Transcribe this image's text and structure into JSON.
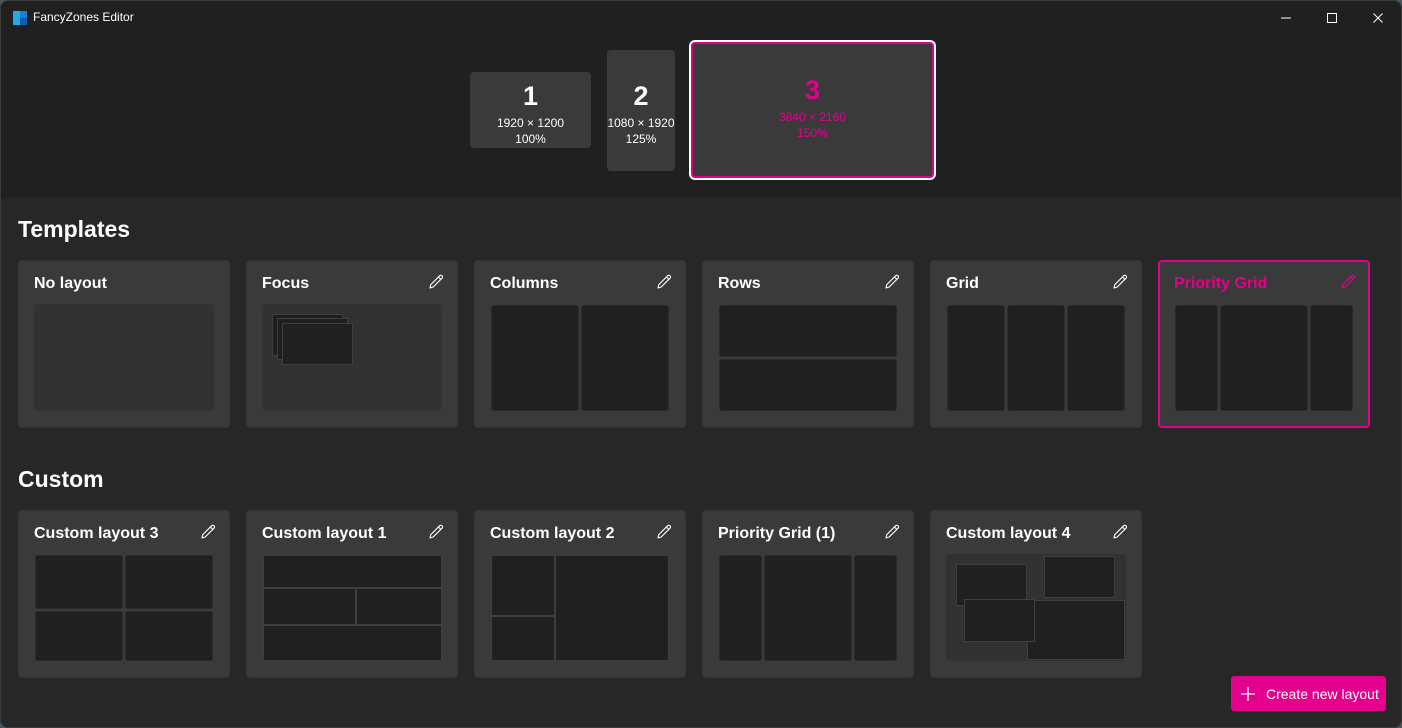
{
  "window": {
    "title": "FancyZones Editor",
    "controls": {
      "minimize": "minimize-icon",
      "maximize": "maximize-icon",
      "close": "close-icon"
    }
  },
  "monitors": [
    {
      "number": "1",
      "resolution": "1920 × 1200",
      "scale": "100%",
      "selected": false
    },
    {
      "number": "2",
      "resolution": "1080 × 1920",
      "scale": "125%",
      "selected": false
    },
    {
      "number": "3",
      "resolution": "3840 × 2160",
      "scale": "150%",
      "selected": true
    }
  ],
  "templates": {
    "title": "Templates",
    "items": [
      {
        "name": "No layout",
        "editable": false,
        "selected": false,
        "preview": "blank"
      },
      {
        "name": "Focus",
        "editable": true,
        "selected": false,
        "preview": "focus"
      },
      {
        "name": "Columns",
        "editable": true,
        "selected": false,
        "preview": "columns"
      },
      {
        "name": "Rows",
        "editable": true,
        "selected": false,
        "preview": "rows"
      },
      {
        "name": "Grid",
        "editable": true,
        "selected": false,
        "preview": "grid"
      },
      {
        "name": "Priority Grid",
        "editable": true,
        "selected": true,
        "preview": "priority-grid"
      }
    ]
  },
  "custom": {
    "title": "Custom",
    "items": [
      {
        "name": "Custom layout 3",
        "editable": true,
        "preview": "2x2-grid"
      },
      {
        "name": "Custom layout 1",
        "editable": true,
        "preview": "row-split-row"
      },
      {
        "name": "Custom layout 2",
        "editable": true,
        "preview": "left-stack-right"
      },
      {
        "name": "Priority Grid (1)",
        "editable": true,
        "preview": "priority-grid"
      },
      {
        "name": "Custom layout 4",
        "editable": true,
        "preview": "canvas-overlap"
      }
    ]
  },
  "actions": {
    "create_new_layout": "Create new layout"
  },
  "colors": {
    "accent": "#e3008c",
    "background": "#202020",
    "card": "#3a3a3a",
    "zone": "#202020"
  }
}
